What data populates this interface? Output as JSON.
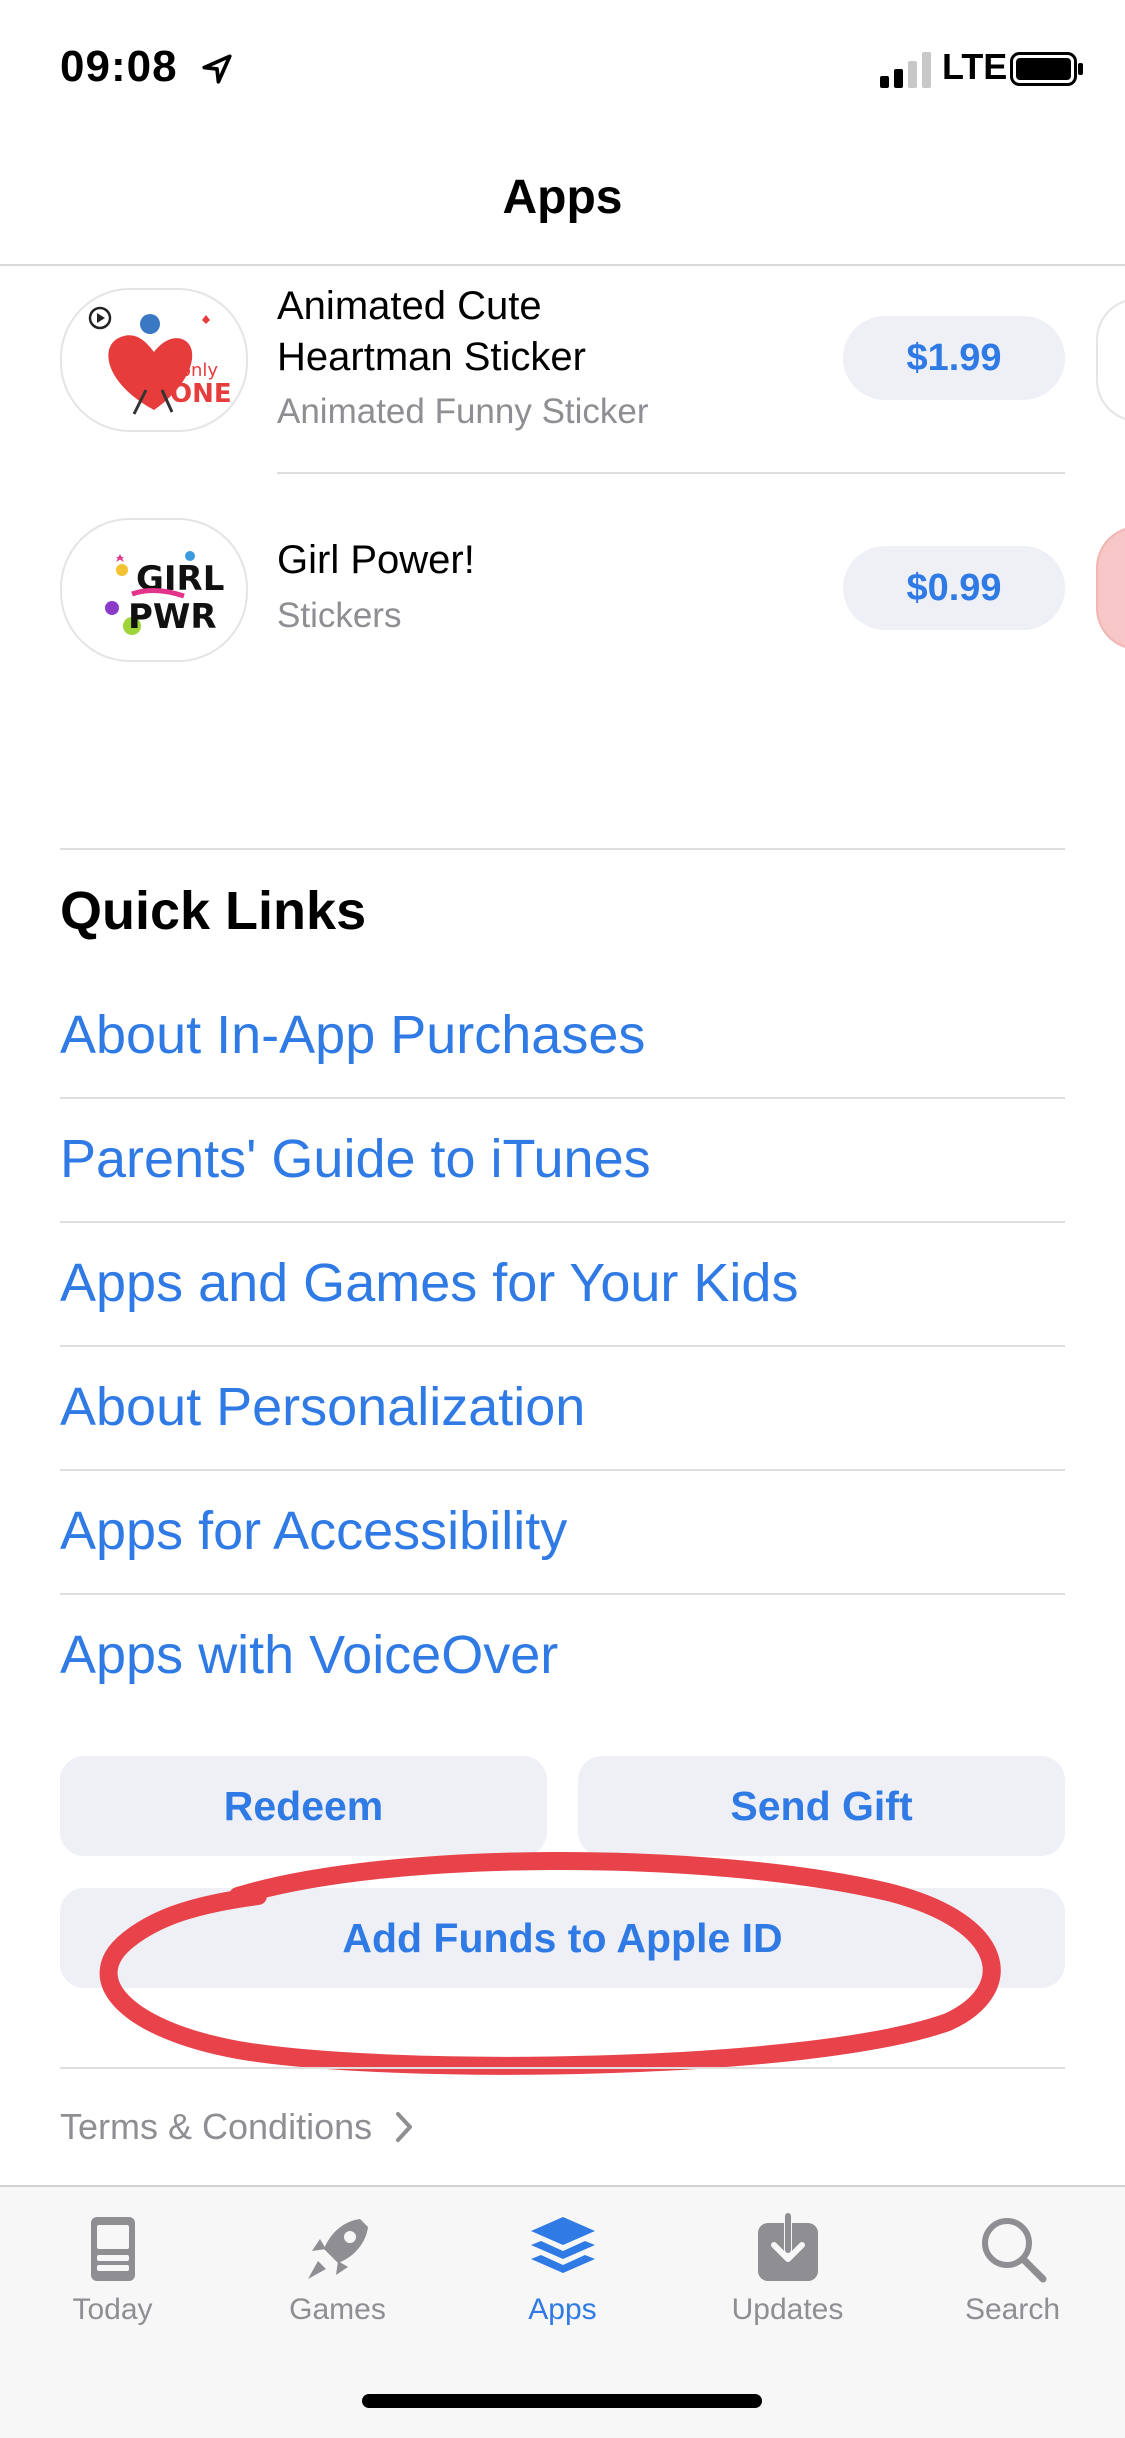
{
  "status_bar": {
    "time": "09:08",
    "network": "LTE"
  },
  "nav": {
    "title": "Apps"
  },
  "apps": [
    {
      "name_line1": "Animated Cute",
      "name_line2": "Heartman Sticker",
      "subtitle": "Animated Funny Sticker",
      "price": "$1.99",
      "icon_text_1": "only",
      "icon_text_2": "ONE"
    },
    {
      "name": "Girl Power!",
      "subtitle": "Stickers",
      "price": "$0.99",
      "icon_text_1": "GIRL",
      "icon_text_2": "PWR"
    }
  ],
  "quick_links": {
    "title": "Quick Links",
    "items": [
      "About In-App Purchases",
      "Parents' Guide to iTunes",
      "Apps and Games for Your Kids",
      "About Personalization",
      "Apps for Accessibility",
      "Apps with VoiceOver"
    ]
  },
  "actions": {
    "redeem": "Redeem",
    "send_gift": "Send Gift",
    "add_funds": "Add Funds to Apple ID"
  },
  "terms": "Terms & Conditions",
  "tabs": [
    {
      "label": "Today",
      "icon": "today-icon",
      "active": false
    },
    {
      "label": "Games",
      "icon": "rocket-icon",
      "active": false
    },
    {
      "label": "Apps",
      "icon": "layers-icon",
      "active": true
    },
    {
      "label": "Updates",
      "icon": "download-icon",
      "active": false
    },
    {
      "label": "Search",
      "icon": "search-icon",
      "active": false
    }
  ],
  "colors": {
    "accent": "#2f7ae5",
    "annotation": "#e8434a",
    "button_bg": "#eff0f5",
    "secondary_text": "#8e8e93"
  }
}
